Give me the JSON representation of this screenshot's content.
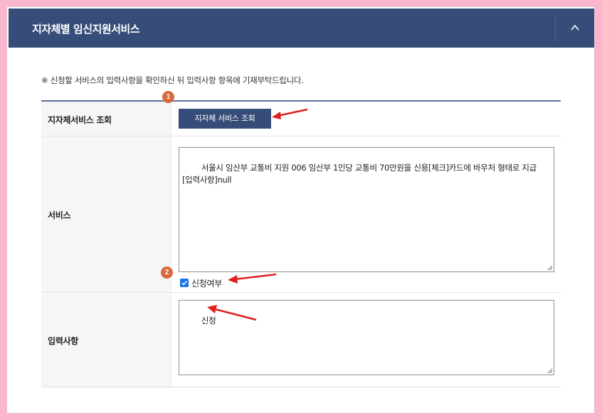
{
  "header": {
    "title": "지자체별 임신지원서비스",
    "collapse_icon": "chevron-up-icon"
  },
  "notice": "※ 신청할 서비스의 입력사항을 확인하신 뒤 입력사항 항목에 기재부탁드립니다.",
  "form": {
    "lookup_row": {
      "label": "지자체서비스 조회",
      "button_label": "지자체 서비스 조회"
    },
    "service_row": {
      "label": "서비스",
      "text_value": "서울시 임산부 교통비 지원 006 임산부 1인당 교통비 70만원을 신용[체크]카드에 바우처 형태로 지급\n[입력사항]null",
      "apply_checkbox_label": "신청여부",
      "apply_checked": true
    },
    "input_row": {
      "label": "입력사항",
      "text_value": "신청"
    }
  },
  "annotations": {
    "marker_1": "1",
    "marker_2": "2",
    "marker_color": "#d9683c",
    "arrow_color": "#e02020"
  },
  "colors": {
    "header_bg": "#354d78",
    "button_bg": "#354d78",
    "page_border": "#f9b6cc",
    "checkbox": "#1a73e8"
  }
}
